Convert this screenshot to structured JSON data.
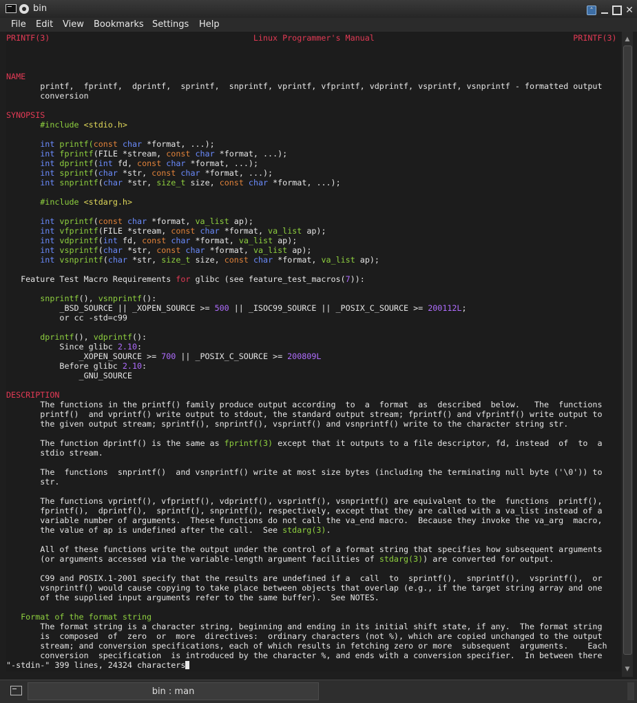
{
  "window": {
    "title": "bin"
  },
  "menu": [
    "File",
    "Edit",
    "View",
    "Bookmarks",
    "Settings",
    "Help"
  ],
  "terminal": {
    "lines": [
      [
        [
          "PRINTF(3)                                          Linux Programmer's Manual                                         PRINTF(3)",
          "red"
        ]
      ],
      [],
      [],
      [],
      [
        [
          "NAME",
          "red"
        ]
      ],
      [
        [
          "       printf,  fprintf,  dprintf,  sprintf,  snprintf, vprintf, vfprintf, vdprintf, vsprintf, vsnprintf - formatted output",
          ""
        ]
      ],
      [
        [
          "       conversion",
          ""
        ]
      ],
      [],
      [
        [
          "SYNOPSIS",
          "red"
        ]
      ],
      [
        [
          "       ",
          ""
        ],
        [
          "#include ",
          "grn"
        ],
        [
          "<stdio.h>",
          "yel"
        ]
      ],
      [],
      [
        [
          "       ",
          ""
        ],
        [
          "int ",
          "blu"
        ],
        [
          "printf",
          "grn"
        ],
        [
          "(",
          "grn"
        ],
        [
          "const ",
          "org"
        ],
        [
          "char ",
          "blu"
        ],
        [
          "*format, ...);",
          ""
        ]
      ],
      [
        [
          "       ",
          ""
        ],
        [
          "int ",
          "blu"
        ],
        [
          "fprintf",
          "grn"
        ],
        [
          "(FILE *stream, ",
          ""
        ],
        [
          "const ",
          "org"
        ],
        [
          "char ",
          "blu"
        ],
        [
          "*format, ...);",
          ""
        ]
      ],
      [
        [
          "       ",
          ""
        ],
        [
          "int ",
          "blu"
        ],
        [
          "dprintf",
          "grn"
        ],
        [
          "(",
          ""
        ],
        [
          "int ",
          "blu"
        ],
        [
          "fd, ",
          ""
        ],
        [
          "const ",
          "org"
        ],
        [
          "char ",
          "blu"
        ],
        [
          "*format, ...);",
          ""
        ]
      ],
      [
        [
          "       ",
          ""
        ],
        [
          "int ",
          "blu"
        ],
        [
          "sprintf",
          "grn"
        ],
        [
          "(",
          ""
        ],
        [
          "char ",
          "blu"
        ],
        [
          "*str, ",
          ""
        ],
        [
          "const ",
          "org"
        ],
        [
          "char ",
          "blu"
        ],
        [
          "*format, ...);",
          ""
        ]
      ],
      [
        [
          "       ",
          ""
        ],
        [
          "int ",
          "blu"
        ],
        [
          "snprintf",
          "grn"
        ],
        [
          "(",
          ""
        ],
        [
          "char ",
          "blu"
        ],
        [
          "*str, ",
          ""
        ],
        [
          "size_t ",
          "grn"
        ],
        [
          "size, ",
          ""
        ],
        [
          "const ",
          "org"
        ],
        [
          "char ",
          "blu"
        ],
        [
          "*format, ...);",
          ""
        ]
      ],
      [],
      [
        [
          "       ",
          ""
        ],
        [
          "#include ",
          "grn"
        ],
        [
          "<stdarg.h>",
          "yel"
        ]
      ],
      [],
      [
        [
          "       ",
          ""
        ],
        [
          "int ",
          "blu"
        ],
        [
          "vprintf",
          "grn"
        ],
        [
          "(",
          ""
        ],
        [
          "const ",
          "org"
        ],
        [
          "char ",
          "blu"
        ],
        [
          "*format, ",
          ""
        ],
        [
          "va_list ",
          "grn"
        ],
        [
          "ap);",
          ""
        ]
      ],
      [
        [
          "       ",
          ""
        ],
        [
          "int ",
          "blu"
        ],
        [
          "vfprintf",
          "grn"
        ],
        [
          "(FILE *stream, ",
          ""
        ],
        [
          "const ",
          "org"
        ],
        [
          "char ",
          "blu"
        ],
        [
          "*format, ",
          ""
        ],
        [
          "va_list ",
          "grn"
        ],
        [
          "ap);",
          ""
        ]
      ],
      [
        [
          "       ",
          ""
        ],
        [
          "int ",
          "blu"
        ],
        [
          "vdprintf",
          "grn"
        ],
        [
          "(",
          ""
        ],
        [
          "int ",
          "blu"
        ],
        [
          "fd, ",
          ""
        ],
        [
          "const ",
          "org"
        ],
        [
          "char ",
          "blu"
        ],
        [
          "*format, ",
          ""
        ],
        [
          "va_list ",
          "grn"
        ],
        [
          "ap);",
          ""
        ]
      ],
      [
        [
          "       ",
          ""
        ],
        [
          "int ",
          "blu"
        ],
        [
          "vsprintf",
          "grn"
        ],
        [
          "(",
          ""
        ],
        [
          "char ",
          "blu"
        ],
        [
          "*str, ",
          ""
        ],
        [
          "const ",
          "org"
        ],
        [
          "char ",
          "blu"
        ],
        [
          "*format, ",
          ""
        ],
        [
          "va_list ",
          "grn"
        ],
        [
          "ap);",
          ""
        ]
      ],
      [
        [
          "       ",
          ""
        ],
        [
          "int ",
          "blu"
        ],
        [
          "vsnprintf",
          "grn"
        ],
        [
          "(",
          ""
        ],
        [
          "char ",
          "blu"
        ],
        [
          "*str, ",
          ""
        ],
        [
          "size_t ",
          "grn"
        ],
        [
          "size, ",
          ""
        ],
        [
          "const ",
          "org"
        ],
        [
          "char ",
          "blu"
        ],
        [
          "*format, ",
          ""
        ],
        [
          "va_list ",
          "grn"
        ],
        [
          "ap);",
          ""
        ]
      ],
      [],
      [
        [
          "   Feature Test Macro Requirements ",
          ""
        ],
        [
          "for ",
          "red"
        ],
        [
          "glibc (see feature_test_macros(",
          ""
        ],
        [
          "7",
          "pur"
        ],
        [
          ")):",
          ""
        ]
      ],
      [],
      [
        [
          "       ",
          ""
        ],
        [
          "snprintf",
          "grn"
        ],
        [
          "(), ",
          ""
        ],
        [
          "vsnprintf",
          "grn"
        ],
        [
          "():",
          ""
        ]
      ],
      [
        [
          "           _BSD_SOURCE || _XOPEN_SOURCE >= ",
          ""
        ],
        [
          "500",
          "pur"
        ],
        [
          " || _ISOC99_SOURCE || _POSIX_C_SOURCE >= ",
          ""
        ],
        [
          "200112L",
          "pur"
        ],
        [
          ";",
          ""
        ]
      ],
      [
        [
          "           or cc -std=c99",
          ""
        ]
      ],
      [],
      [
        [
          "       ",
          ""
        ],
        [
          "dprintf",
          "grn"
        ],
        [
          "(), ",
          ""
        ],
        [
          "vdprintf",
          "grn"
        ],
        [
          "():",
          ""
        ]
      ],
      [
        [
          "           Since glibc ",
          ""
        ],
        [
          "2.10",
          "pur"
        ],
        [
          ":",
          ""
        ]
      ],
      [
        [
          "               _XOPEN_SOURCE >= ",
          ""
        ],
        [
          "700",
          "pur"
        ],
        [
          " || _POSIX_C_SOURCE >= ",
          ""
        ],
        [
          "200809L",
          "pur"
        ]
      ],
      [
        [
          "           Before glibc ",
          ""
        ],
        [
          "2.10",
          "pur"
        ],
        [
          ":",
          ""
        ]
      ],
      [
        [
          "               _GNU_SOURCE",
          ""
        ]
      ],
      [],
      [
        [
          "DESCRIPTION",
          "red"
        ]
      ],
      [
        [
          "       The functions in the printf() family produce output according  to  a  format  as  described  below.   The  functions",
          ""
        ]
      ],
      [
        [
          "       printf()  and vprintf() write output to stdout, the standard output stream; fprintf() and vfprintf() write output to",
          ""
        ]
      ],
      [
        [
          "       the given output stream; sprintf(), snprintf(), vsprintf() and vsnprintf() write to the character string str.",
          ""
        ]
      ],
      [],
      [
        [
          "       The function dprintf() is the same as ",
          ""
        ],
        [
          "fprintf(3)",
          "grn"
        ],
        [
          " except that it outputs to a file descriptor, fd, instead  of  to  a",
          ""
        ]
      ],
      [
        [
          "       stdio stream.",
          ""
        ]
      ],
      [],
      [
        [
          "       The  functions  snprintf()  and vsnprintf() write at most size bytes (including the terminating null byte ('\\0')) to",
          ""
        ]
      ],
      [
        [
          "       str.",
          ""
        ]
      ],
      [],
      [
        [
          "       The functions vprintf(), vfprintf(), vdprintf(), vsprintf(), vsnprintf() are equivalent to the  functions  printf(),",
          ""
        ]
      ],
      [
        [
          "       fprintf(),  dprintf(),  sprintf(), snprintf(), respectively, except that they are called with a va_list instead of a",
          ""
        ]
      ],
      [
        [
          "       variable number of arguments.  These functions do not call the va_end macro.  Because they invoke the va_arg  macro,",
          ""
        ]
      ],
      [
        [
          "       the value of ap is undefined after the call.  See ",
          ""
        ],
        [
          "stdarg(3)",
          "grn"
        ],
        [
          ".",
          ""
        ]
      ],
      [],
      [
        [
          "       All of these functions write the output under the control of a format string that specifies how subsequent arguments",
          ""
        ]
      ],
      [
        [
          "       (or arguments accessed via the variable-length argument facilities of ",
          ""
        ],
        [
          "stdarg(3)",
          "grn"
        ],
        [
          ") are converted for output.",
          ""
        ]
      ],
      [],
      [
        [
          "       C99 and POSIX.1-2001 specify that the results are undefined if a  call  to  sprintf(),  snprintf(),  vsprintf(),  or",
          ""
        ]
      ],
      [
        [
          "       vsnprintf() would cause copying to take place between objects that overlap (e.g., if the target string array and one",
          ""
        ]
      ],
      [
        [
          "       of the supplied input arguments refer to the same buffer).  See NOTES.",
          ""
        ]
      ],
      [],
      [
        [
          "   Format of the format string",
          "grn"
        ]
      ],
      [
        [
          "       The format string is a character string, beginning and ending in its initial shift state, if any.  The format string",
          ""
        ]
      ],
      [
        [
          "       is  composed  of  zero  or  more  directives:  ordinary characters (not %), which are copied unchanged to the output",
          ""
        ]
      ],
      [
        [
          "       stream; and conversion specifications, each of which results in fetching zero or more  subsequent  arguments.    Each",
          ""
        ]
      ],
      [
        [
          "       conversion  specification  is introduced by the character %, and ends with a conversion specifier.  In between there",
          ""
        ]
      ]
    ],
    "status": "\"-stdin-\" 399 lines, 24324 characters"
  },
  "tab": {
    "label": "bin : man"
  }
}
